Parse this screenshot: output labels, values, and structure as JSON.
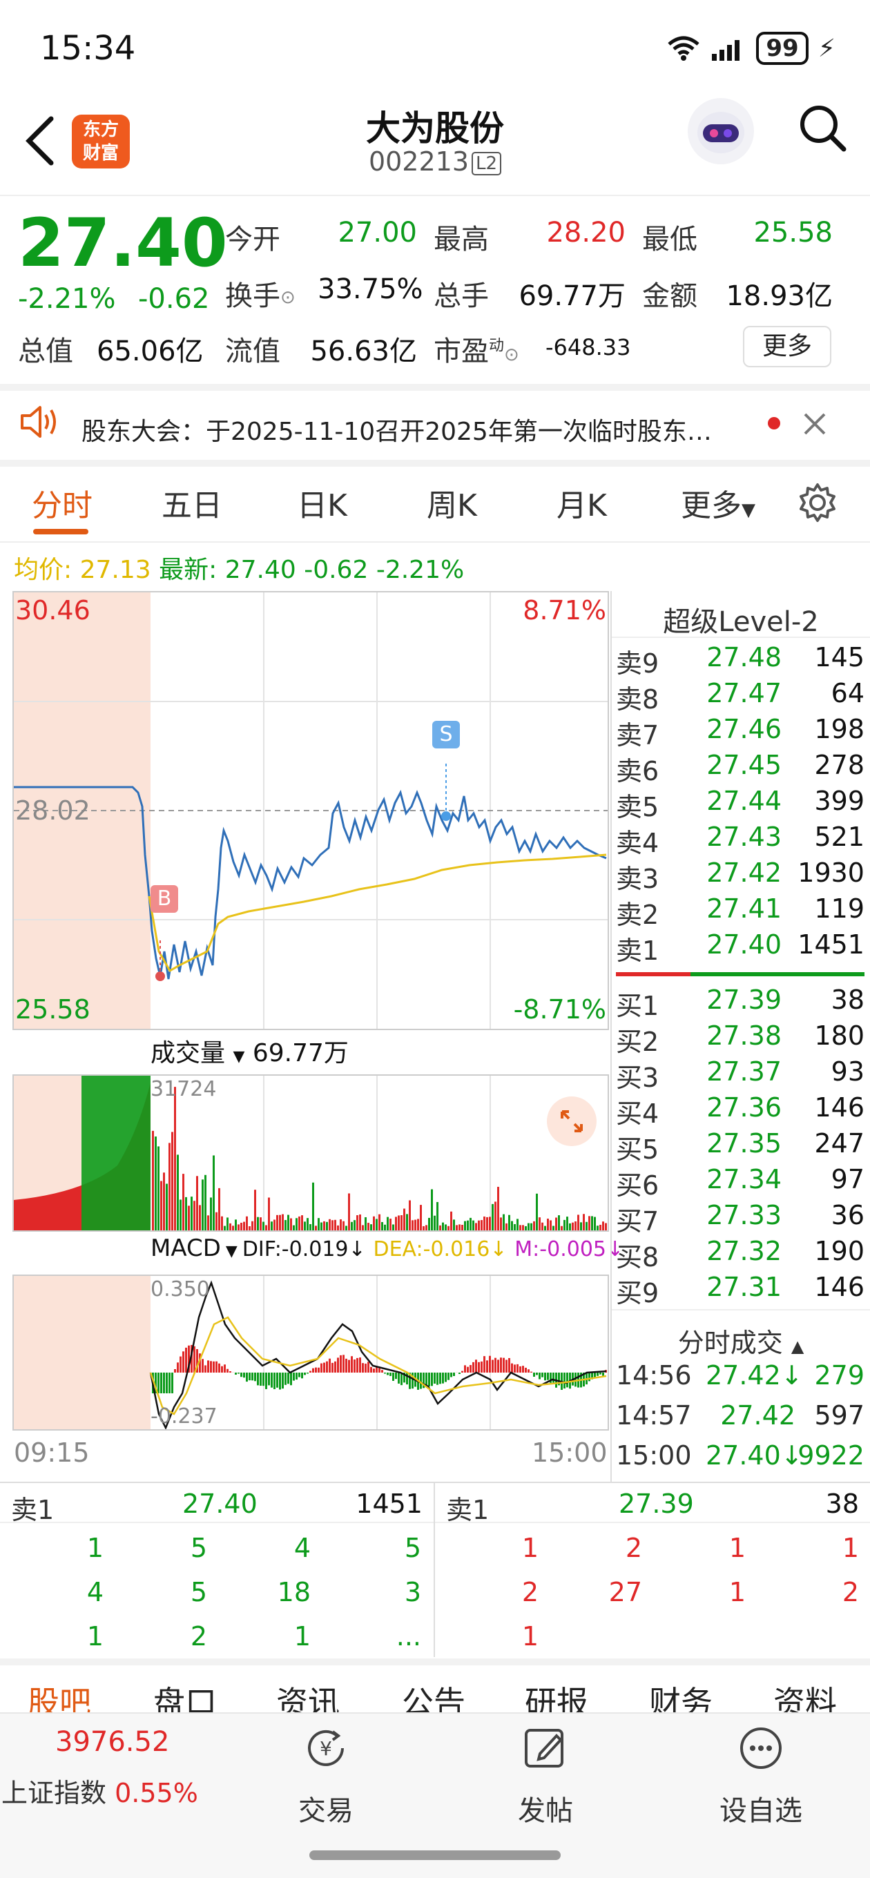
{
  "status_bar": {
    "time": "15:34",
    "battery": "99"
  },
  "header": {
    "logo_line1": "东方",
    "logo_line2": "财富",
    "title": "大为股份",
    "code": "002213",
    "badge": "L2"
  },
  "quote": {
    "price": "27.40",
    "change_pct": "-2.21%",
    "change": "-0.62",
    "open_label": "今开",
    "open": "27.00",
    "high_label": "最高",
    "high": "28.20",
    "low_label": "最低",
    "low": "25.58",
    "turnover_label": "换手",
    "turnover": "33.75%",
    "volume_label": "总手",
    "volume": "69.77万",
    "amount_label": "金额",
    "amount": "18.93亿",
    "mktcap_label": "总值",
    "mktcap": "65.06亿",
    "float_label": "流值",
    "float_cap": "56.63亿",
    "pe_label": "市盈",
    "pe_sup": "动",
    "pe": "-648.33",
    "more_label": "更多"
  },
  "notice": {
    "text": "股东大会：于2025-11-10召开2025年第一次临时股东…"
  },
  "tabs": [
    "分时",
    "五日",
    "日K",
    "周K",
    "月K",
    "更多"
  ],
  "info_line": {
    "avg_label": "均价:",
    "avg": "27.13",
    "latest_label": "最新:",
    "latest": "27.40",
    "chg": "-0.62",
    "pct": "-2.21%"
  },
  "chart": {
    "price_high": "30.46",
    "price_mid": "28.02",
    "price_low": "25.58",
    "pct_high": "8.71%",
    "pct_low": "-8.71%",
    "volume_label": "成交量",
    "volume_value": "69.77万",
    "volume_max": "31724",
    "macd_label": "MACD",
    "dif": "DIF:-0.019↓",
    "dea": "DEA:-0.016↓",
    "m": "M:-0.005↓",
    "macd_max": "0.350",
    "macd_min": "-0.237",
    "time_start": "09:15",
    "time_end": "15:00",
    "buy_marker": "B",
    "sell_marker": "S"
  },
  "level2": {
    "title": "超级Level-2",
    "asks": [
      {
        "label": "卖9",
        "price": "27.48",
        "vol": "145"
      },
      {
        "label": "卖8",
        "price": "27.47",
        "vol": "64"
      },
      {
        "label": "卖7",
        "price": "27.46",
        "vol": "198"
      },
      {
        "label": "卖6",
        "price": "27.45",
        "vol": "278"
      },
      {
        "label": "卖5",
        "price": "27.44",
        "vol": "399"
      },
      {
        "label": "卖4",
        "price": "27.43",
        "vol": "521"
      },
      {
        "label": "卖3",
        "price": "27.42",
        "vol": "1930"
      },
      {
        "label": "卖2",
        "price": "27.41",
        "vol": "119"
      },
      {
        "label": "卖1",
        "price": "27.40",
        "vol": "1451"
      }
    ],
    "bids": [
      {
        "label": "买1",
        "price": "27.39",
        "vol": "38"
      },
      {
        "label": "买2",
        "price": "27.38",
        "vol": "180"
      },
      {
        "label": "买3",
        "price": "27.37",
        "vol": "93"
      },
      {
        "label": "买4",
        "price": "27.36",
        "vol": "146"
      },
      {
        "label": "买5",
        "price": "27.35",
        "vol": "247"
      },
      {
        "label": "买6",
        "price": "27.34",
        "vol": "97"
      },
      {
        "label": "买7",
        "price": "27.33",
        "vol": "36"
      },
      {
        "label": "买8",
        "price": "27.32",
        "vol": "190"
      },
      {
        "label": "买9",
        "price": "27.31",
        "vol": "146"
      }
    ],
    "trades_title": "分时成交",
    "trades": [
      {
        "time": "14:56",
        "price": "27.42↓",
        "vol": "279"
      },
      {
        "time": "14:57",
        "price": "27.42",
        "vol": "597"
      },
      {
        "time": "15:00",
        "price": "27.40↓",
        "vol": "9922"
      }
    ]
  },
  "queue": {
    "sell_label": "卖1",
    "sell_price": "27.40",
    "sell_vol": "1451",
    "buy_label": "卖1",
    "buy_price": "27.39",
    "buy_vol": "38",
    "sell_rows": [
      [
        "1",
        "5",
        "4",
        "5"
      ],
      [
        "4",
        "5",
        "18",
        "3"
      ],
      [
        "1",
        "2",
        "1",
        "..."
      ]
    ],
    "buy_rows": [
      [
        "1",
        "2",
        "1",
        "1"
      ],
      [
        "2",
        "27",
        "1",
        "2"
      ],
      [
        "1",
        "",
        "",
        ""
      ]
    ]
  },
  "bottom_tabs": [
    "股吧",
    "盘口",
    "资讯",
    "公告",
    "研报",
    "财务",
    "资料"
  ],
  "bottom_nav": {
    "index_value": "3976.52",
    "index_name": "上证指数",
    "index_pct": "0.55%",
    "trade_label": "交易",
    "post_label": "发帖",
    "watch_label": "设自选"
  },
  "colors": {
    "accent": "#e05a14",
    "up": "#e02828",
    "down": "#0d9b1c",
    "avg_line": "#e8c21a",
    "price_line": "#2f6fb8"
  }
}
